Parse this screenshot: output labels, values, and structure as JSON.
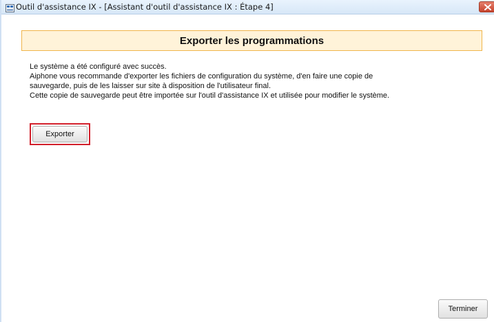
{
  "window": {
    "title": "Outil d'assistance IX - [Assistant d'outil d'assistance IX : Étape 4]",
    "app_icon": "app-icon",
    "close_icon": "close-icon"
  },
  "header": {
    "title": "Exporter les programmations"
  },
  "body": {
    "lines": [
      "Le système a été configuré avec succès.",
      "Aiphone vous recommande d'exporter les fichiers de configuration du système, d'en faire une copie de",
      "sauvegarde, puis de les laisser sur site à disposition de l'utilisateur final.",
      "Cette copie de sauvegarde peut être importée sur l'outil d'assistance IX et utilisée pour modifier le système."
    ]
  },
  "buttons": {
    "export_label": "Exporter",
    "finish_label": "Terminer"
  },
  "colors": {
    "header_background": "#fff3d9",
    "header_border": "#f0b54a",
    "highlight_border": "#d21f2b",
    "close_button": "#c7442e"
  }
}
